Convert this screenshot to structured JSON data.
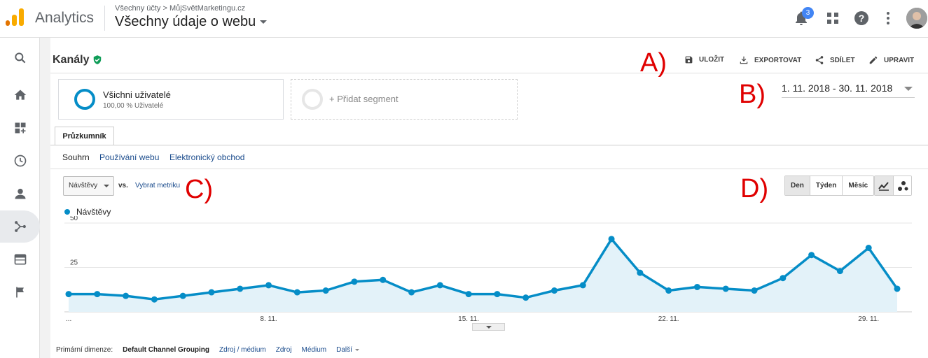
{
  "app": {
    "brand": "Analytics",
    "account_breadcrumb": "Všechny účty > MůjSvětMarketingu.cz",
    "view_name": "Všechny údaje o webu",
    "notifications_count": "3"
  },
  "page": {
    "title": "Kanály",
    "actions": {
      "save": "ULOŽIT",
      "export": "EXPORTOVAT",
      "share": "SDÍLET",
      "edit": "UPRAVIT"
    }
  },
  "annotations": {
    "a": "A)",
    "b": "B)",
    "c": "C)",
    "d": "D)"
  },
  "segments": {
    "active_name": "Všichni uživatelé",
    "active_sub": "100,00 % Uživatelé",
    "add_label": "+ Přidat segment"
  },
  "date_range": "1. 11. 2018 - 30. 11. 2018",
  "tabs": {
    "explorer": "Průzkumník"
  },
  "subtabs": {
    "summary": "Souhrn",
    "site_usage": "Používání webu",
    "ecommerce": "Elektronický obchod"
  },
  "metric_controls": {
    "selected_metric": "Návštěvy",
    "vs": "vs.",
    "pick_metric": "Vybrat metriku"
  },
  "period_buttons": {
    "day": "Den",
    "week": "Týden",
    "month": "Měsíc"
  },
  "chart_data": {
    "type": "area",
    "series": [
      {
        "name": "Návštěvy",
        "values": [
          10,
          10,
          9,
          7,
          9,
          11,
          13,
          15,
          11,
          12,
          17,
          18,
          11,
          15,
          10,
          10,
          8,
          12,
          15,
          41,
          22,
          12,
          14,
          13,
          12,
          19,
          32,
          23,
          36,
          13
        ]
      }
    ],
    "x_tick_labels": [
      "...",
      "8. 11.",
      "15. 11.",
      "22. 11.",
      "29. 11."
    ],
    "y_tick_labels": [
      "50",
      "25"
    ],
    "ylim": [
      0,
      50
    ],
    "color": "#058dc7"
  },
  "dimensions": {
    "label": "Primární dimenze:",
    "current": "Default Channel Grouping",
    "options": [
      "Zdroj / médium",
      "Zdroj",
      "Médium"
    ],
    "more": "Další"
  }
}
